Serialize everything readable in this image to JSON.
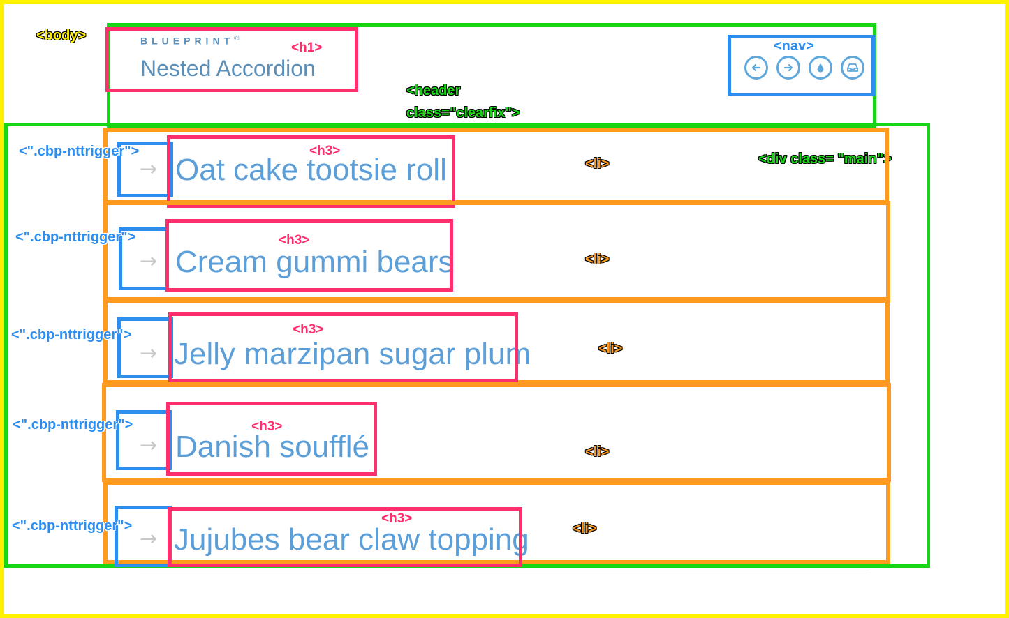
{
  "tags": {
    "body": "<body>",
    "header_line1": "<header",
    "header_line2": "class=\"clearfix\">",
    "h1": "<h1>",
    "nav": "<nav>",
    "main": "<div class= \"main\">",
    "h3": "<h3>",
    "li": "<li>",
    "trigger": "<\".cbp-nttrigger\">"
  },
  "header": {
    "brand": "BLUEPRINT",
    "brand_mark": "®",
    "title": "Nested Accordion"
  },
  "nav": {
    "buttons": [
      {
        "icon": "arrow-left-icon"
      },
      {
        "icon": "arrow-right-icon"
      },
      {
        "icon": "drop-icon"
      },
      {
        "icon": "inbox-icon"
      }
    ]
  },
  "accordion": {
    "items": [
      {
        "title": "Oat cake tootsie roll"
      },
      {
        "title": "Cream gummi bears"
      },
      {
        "title": "Jelly marzipan sugar plum"
      },
      {
        "title": "Danish soufflé"
      },
      {
        "title": "Jujubes bear claw topping"
      }
    ]
  },
  "colors": {
    "body_outline": "#fff200",
    "header_outline": "#16d616",
    "h_outline": "#ff2f6d",
    "nav_outline": "#2d8ef0",
    "li_outline": "#ff9a1f",
    "text_blue": "#5c9fd8"
  }
}
